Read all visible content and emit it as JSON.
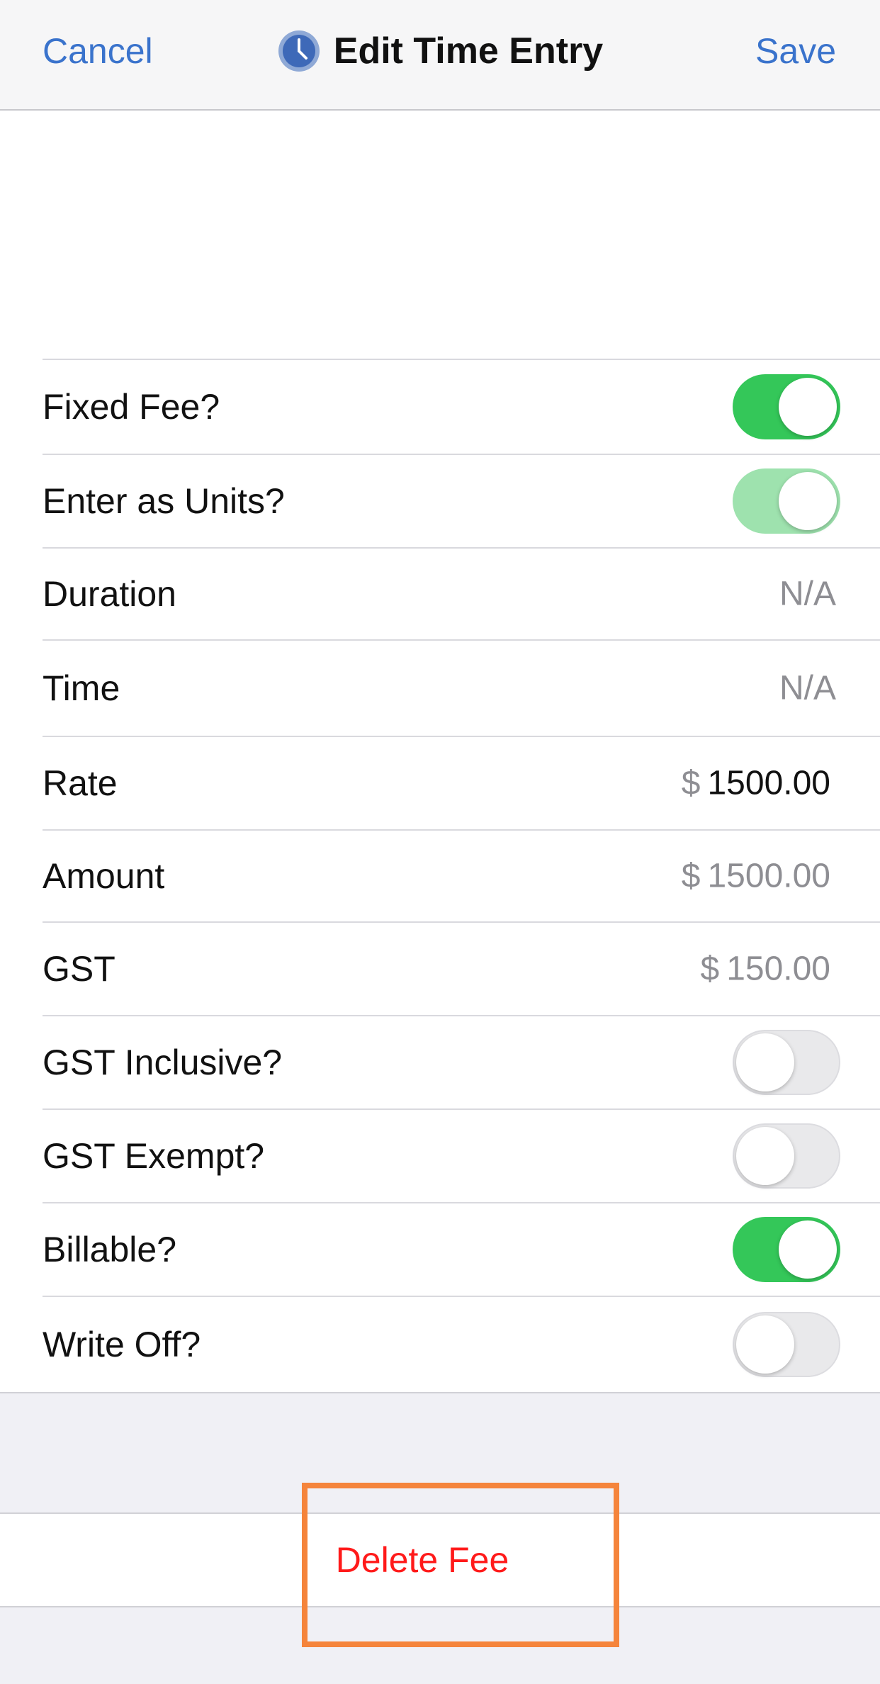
{
  "nav": {
    "cancel_label": "Cancel",
    "title": "Edit Time Entry",
    "save_label": "Save",
    "title_icon": "clock-icon",
    "accent_color": "#3a73cc"
  },
  "rows": {
    "fixed_fee": {
      "label": "Fixed Fee?",
      "toggle": "on"
    },
    "enter_as_units": {
      "label": "Enter as Units?",
      "toggle": "on-disabled"
    },
    "duration": {
      "label": "Duration",
      "value": "N/A"
    },
    "time": {
      "label": "Time",
      "value": "N/A"
    },
    "rate": {
      "label": "Rate",
      "currency": "$",
      "value": "1500.00"
    },
    "amount": {
      "label": "Amount",
      "currency": "$",
      "value": "1500.00"
    },
    "gst": {
      "label": "GST",
      "currency": "$",
      "value": "150.00"
    },
    "gst_inclusive": {
      "label": "GST Inclusive?",
      "toggle": "off"
    },
    "gst_exempt": {
      "label": "GST Exempt?",
      "toggle": "off"
    },
    "billable": {
      "label": "Billable?",
      "toggle": "on"
    },
    "write_off": {
      "label": "Write Off?",
      "toggle": "off"
    }
  },
  "delete": {
    "label": "Delete Fee",
    "color": "#ff1a1a",
    "highlight_color": "#f5843b"
  },
  "colors": {
    "toggle_on": "#34c759",
    "toggle_off": "#e9e9eb"
  }
}
